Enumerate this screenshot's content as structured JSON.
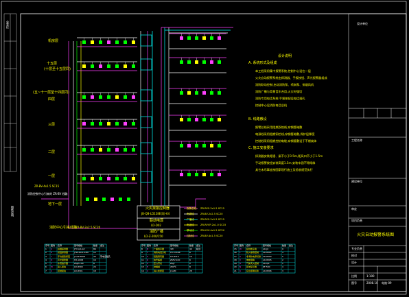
{
  "frame": {
    "left_strip_label": "会签栏",
    "left_vertical_text": "图纸说明"
  },
  "floors": [
    {
      "label": "机房层"
    },
    {
      "label": "十五层"
    },
    {
      "label": "(十层至十五层同)"
    },
    {
      "label": "(五~十一层至十四层同)"
    },
    {
      "label": "四层"
    },
    {
      "label": "三层"
    },
    {
      "label": "二层"
    },
    {
      "label": "一层"
    },
    {
      "label": "地下一层"
    }
  ],
  "annotations": {
    "cable_top": "ZR-BV-4x1.5 SC15",
    "cable_bottom_left": "消防中心引来线路",
    "cable_bottom_right": "ZR-BV-2x2.5 SC20",
    "note_left_small": "消防控制中心引来的 ZR-BV 线路"
  },
  "panel": {
    "title": "火灾报警控制器",
    "line1": "JB-QB-LD128E(Q)-64",
    "line2": "联动电源",
    "line3": "LD-D02",
    "line4": "消防广播",
    "line5": "LD-Z-200/150"
  },
  "legend_cables": [
    {
      "label": "报警总线",
      "spec": "ZR-RVS-2x1.5 SC15"
    },
    {
      "label": "电源线",
      "spec": "ZR-BV-2x2.5 SC20"
    },
    {
      "label": "广播线",
      "spec": "ZR-RVS-2x1.5 SC15"
    },
    {
      "label": "电话线",
      "spec": "ZR-RVVP-2x1.0 SC15"
    },
    {
      "label": "联动线",
      "spec": "ZR-KVV-4x1.5 SC20"
    },
    {
      "label": "控制线",
      "spec": "ZR-BV-4x1.5 SC20"
    }
  ],
  "design_notes": {
    "title": "设计说明",
    "sec_a": "A. 系统形式及组成",
    "a_lines": [
      "本工程采用集中报警系统,控制中心设在一层",
      "火灾自动报警系统由探测器、手报按钮、声光报警器组成",
      "消防联动控制:启动消防泵、喷淋泵、排烟风机",
      "消防广播与背景音乐合用,火灾时强切",
      "消防专用电话系统:手报按钮设电话插孔",
      "控制中心设消防电话总机"
    ],
    "sec_b": "B. 线路敷设",
    "b_lines": [
      "报警总线采用阻燃双绞线,穿钢管暗敷",
      "电源线采用阻燃铜芯线,穿钢管暗敷,保护层厚度",
      "控制线采用阻燃控制电缆,穿钢管敷设于不燃烧体"
    ],
    "sec_c": "C. 施工安装要求",
    "c_lines": [
      "探测器安装距墙、梁不小于0.5m,距风口不小于1.5m",
      "手动报警按钮安装高度1.5m,安装牢固不得倾斜",
      "其它未尽事宜按国家现行施工及验收规范执行"
    ]
  },
  "title_block": {
    "r1": "设计单位",
    "r2": "工程名称",
    "r3": "建设单位",
    "r4": "审定",
    "r5": "项目负责",
    "r6": "专业负责",
    "r7": "校对",
    "r8": "设计",
    "drawing_title": "火灾自动报警系统图",
    "sheet_label": "图号",
    "sheet_no": "电施-09",
    "date": "2008.10",
    "scale": "比例",
    "scale_val": "1:100"
  },
  "legend_table": {
    "headers": [
      "序号",
      "图例",
      "名称",
      "型号规格",
      "数量",
      "备注"
    ],
    "left_rows": [
      [
        "1",
        "S",
        "感烟探测器",
        "JTY-GD-G3",
        "86",
        ""
      ],
      [
        "2",
        "H",
        "感温探测器",
        "JTW-ZCD-G3N",
        "12",
        ""
      ],
      [
        "3",
        "Y",
        "手动报警按钮",
        "J-SAP-8402",
        "30",
        "带电话插孔"
      ],
      [
        "4",
        "D",
        "声光报警器",
        "HX-100B",
        "16",
        ""
      ],
      [
        "5",
        "F",
        "水流指示器",
        "ZSJZ-100",
        "8",
        ""
      ],
      [
        "6",
        "M",
        "输入模块",
        "LD-8300",
        "24",
        ""
      ],
      [
        "7",
        "C",
        "控制模块",
        "LD-8301",
        "18",
        ""
      ]
    ],
    "mid_rows": [
      [
        "8",
        "B",
        "广播扬声器",
        "3W",
        "40",
        "吸顶"
      ],
      [
        "9",
        "T",
        "消防电话分机",
        "HY-5716B",
        "6",
        ""
      ],
      [
        "10",
        "K",
        "短路隔离器",
        "LD-8313",
        "10",
        ""
      ],
      [
        "11",
        "R",
        "信号蝶阀",
        "ZSFV-100",
        "6",
        ""
      ],
      [
        "12",
        "P",
        "压力开关",
        "ZSJY",
        "2",
        ""
      ],
      [
        "13",
        "E",
        "排烟阀",
        "280℃",
        "8",
        ""
      ],
      [
        "14",
        "X",
        "消火栓按钮",
        "J-SAM",
        "28",
        ""
      ]
    ],
    "right_rows": [
      [
        "15",
        "W",
        "接线端子箱",
        "LD-JX",
        "9",
        ""
      ],
      [
        "16",
        "L",
        "防火卷帘控制",
        "LD-8302",
        "4",
        ""
      ],
      [
        "17",
        "A",
        "非消防电源切除",
        "LD-8304",
        "5",
        ""
      ],
      [
        "18",
        "V",
        "电梯迫降",
        "LD-8305",
        "2",
        ""
      ],
      [
        "19",
        "G",
        "气体灭火控制",
        "LD-QK",
        "1",
        ""
      ],
      [
        "20",
        "N",
        "区域显示器",
        "ZF-500",
        "4",
        ""
      ],
      [
        "21",
        "U",
        "应急照明切换",
        "LD-8306",
        "3",
        ""
      ]
    ]
  },
  "colors": {
    "bg": "#000000",
    "frame": "#ffffff",
    "riser": "#00ffff",
    "bus": "#ff40ff",
    "text": "#ffff00",
    "device": "#00ff00"
  }
}
